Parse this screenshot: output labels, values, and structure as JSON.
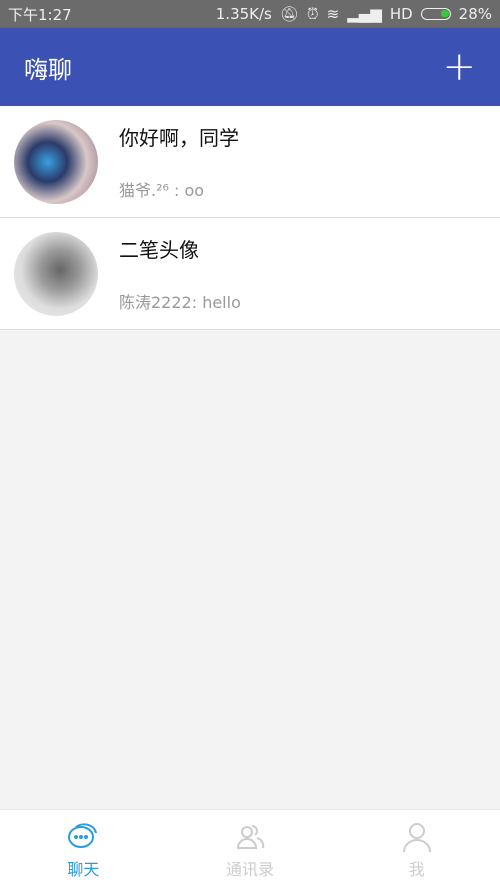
{
  "status": {
    "time": "下午1:27",
    "speed": "1.35K/s",
    "network": "HD",
    "battery": "28%"
  },
  "appbar": {
    "title": "嗨聊",
    "add_label": "+"
  },
  "conversations": [
    {
      "name": "你好啊，同学",
      "last": "猫爷.²⁶ : oo"
    },
    {
      "name": "二笔头像",
      "last": "陈涛2222: hello"
    }
  ],
  "tabs": [
    {
      "label": "聊天",
      "icon": "chat-icon",
      "active": true
    },
    {
      "label": "通讯录",
      "icon": "contacts-icon"
    },
    {
      "label": "我",
      "icon": "person-icon"
    }
  ],
  "colors": {
    "primary": "#3c51b4",
    "accent": "#2a9be0"
  }
}
